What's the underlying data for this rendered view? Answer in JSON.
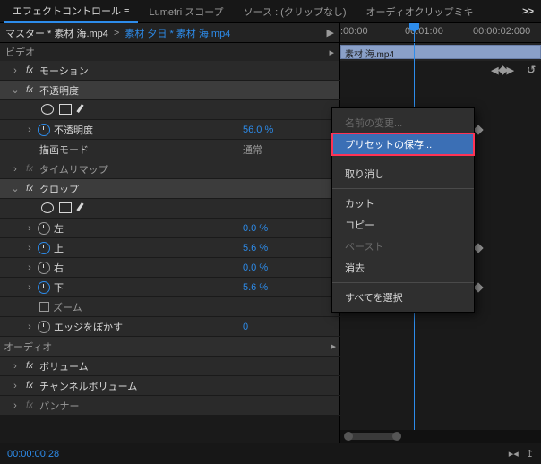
{
  "panel_tabs": {
    "effect_controls": "エフェクトコントロール",
    "lumetri": "Lumetri スコープ",
    "source": "ソース : (クリップなし)",
    "audio_mixer": "オーディオクリップミキ",
    "overflow": ">>"
  },
  "subhead": {
    "master": "マスター * 素材 海.mp4",
    "clip": "素材 夕日 * 素材 海.mp4",
    "play_arrow": "▶"
  },
  "ruler": {
    "t0": ":00:00",
    "t1": "00:01:00",
    "t2": "00:00:02:00",
    "t00": "00"
  },
  "clip_label": "素材 海.mp4",
  "sections": {
    "video": "ビデオ",
    "audio": "オーディオ"
  },
  "effects": {
    "motion": "モーション",
    "opacity": "不透明度",
    "opacity_param": "不透明度",
    "opacity_value": "56.0 %",
    "blend_mode": "描画モード",
    "blend_value": "通常",
    "time_remap": "タイムリマップ",
    "crop": "クロップ",
    "left": "左",
    "left_val": "0.0 %",
    "top": "上",
    "top_val": "5.6 %",
    "right": "右",
    "right_val": "0.0 %",
    "bottom": "下",
    "bottom_val": "5.6 %",
    "zoom": "ズーム",
    "edge_feather": "エッジをぼかす",
    "edge_feather_val": "0",
    "volume": "ボリューム",
    "channel_volume": "チャンネルボリューム",
    "panner": "パンナー"
  },
  "fx_label": "fx",
  "reset_icon": "↺",
  "twisty_open": "⌄",
  "twisty_closed": "›",
  "key_prev": "◀",
  "key_next": "▶",
  "context_menu": {
    "rename": "名前の変更...",
    "save_preset": "プリセットの保存...",
    "undo": "取り消し",
    "cut": "カット",
    "copy": "コピー",
    "paste": "ペースト",
    "clear": "消去",
    "select_all": "すべてを選択"
  },
  "footer": {
    "timecode": "00:00:00:28",
    "tool_icon": "▸◂",
    "export_icon": "↥"
  }
}
